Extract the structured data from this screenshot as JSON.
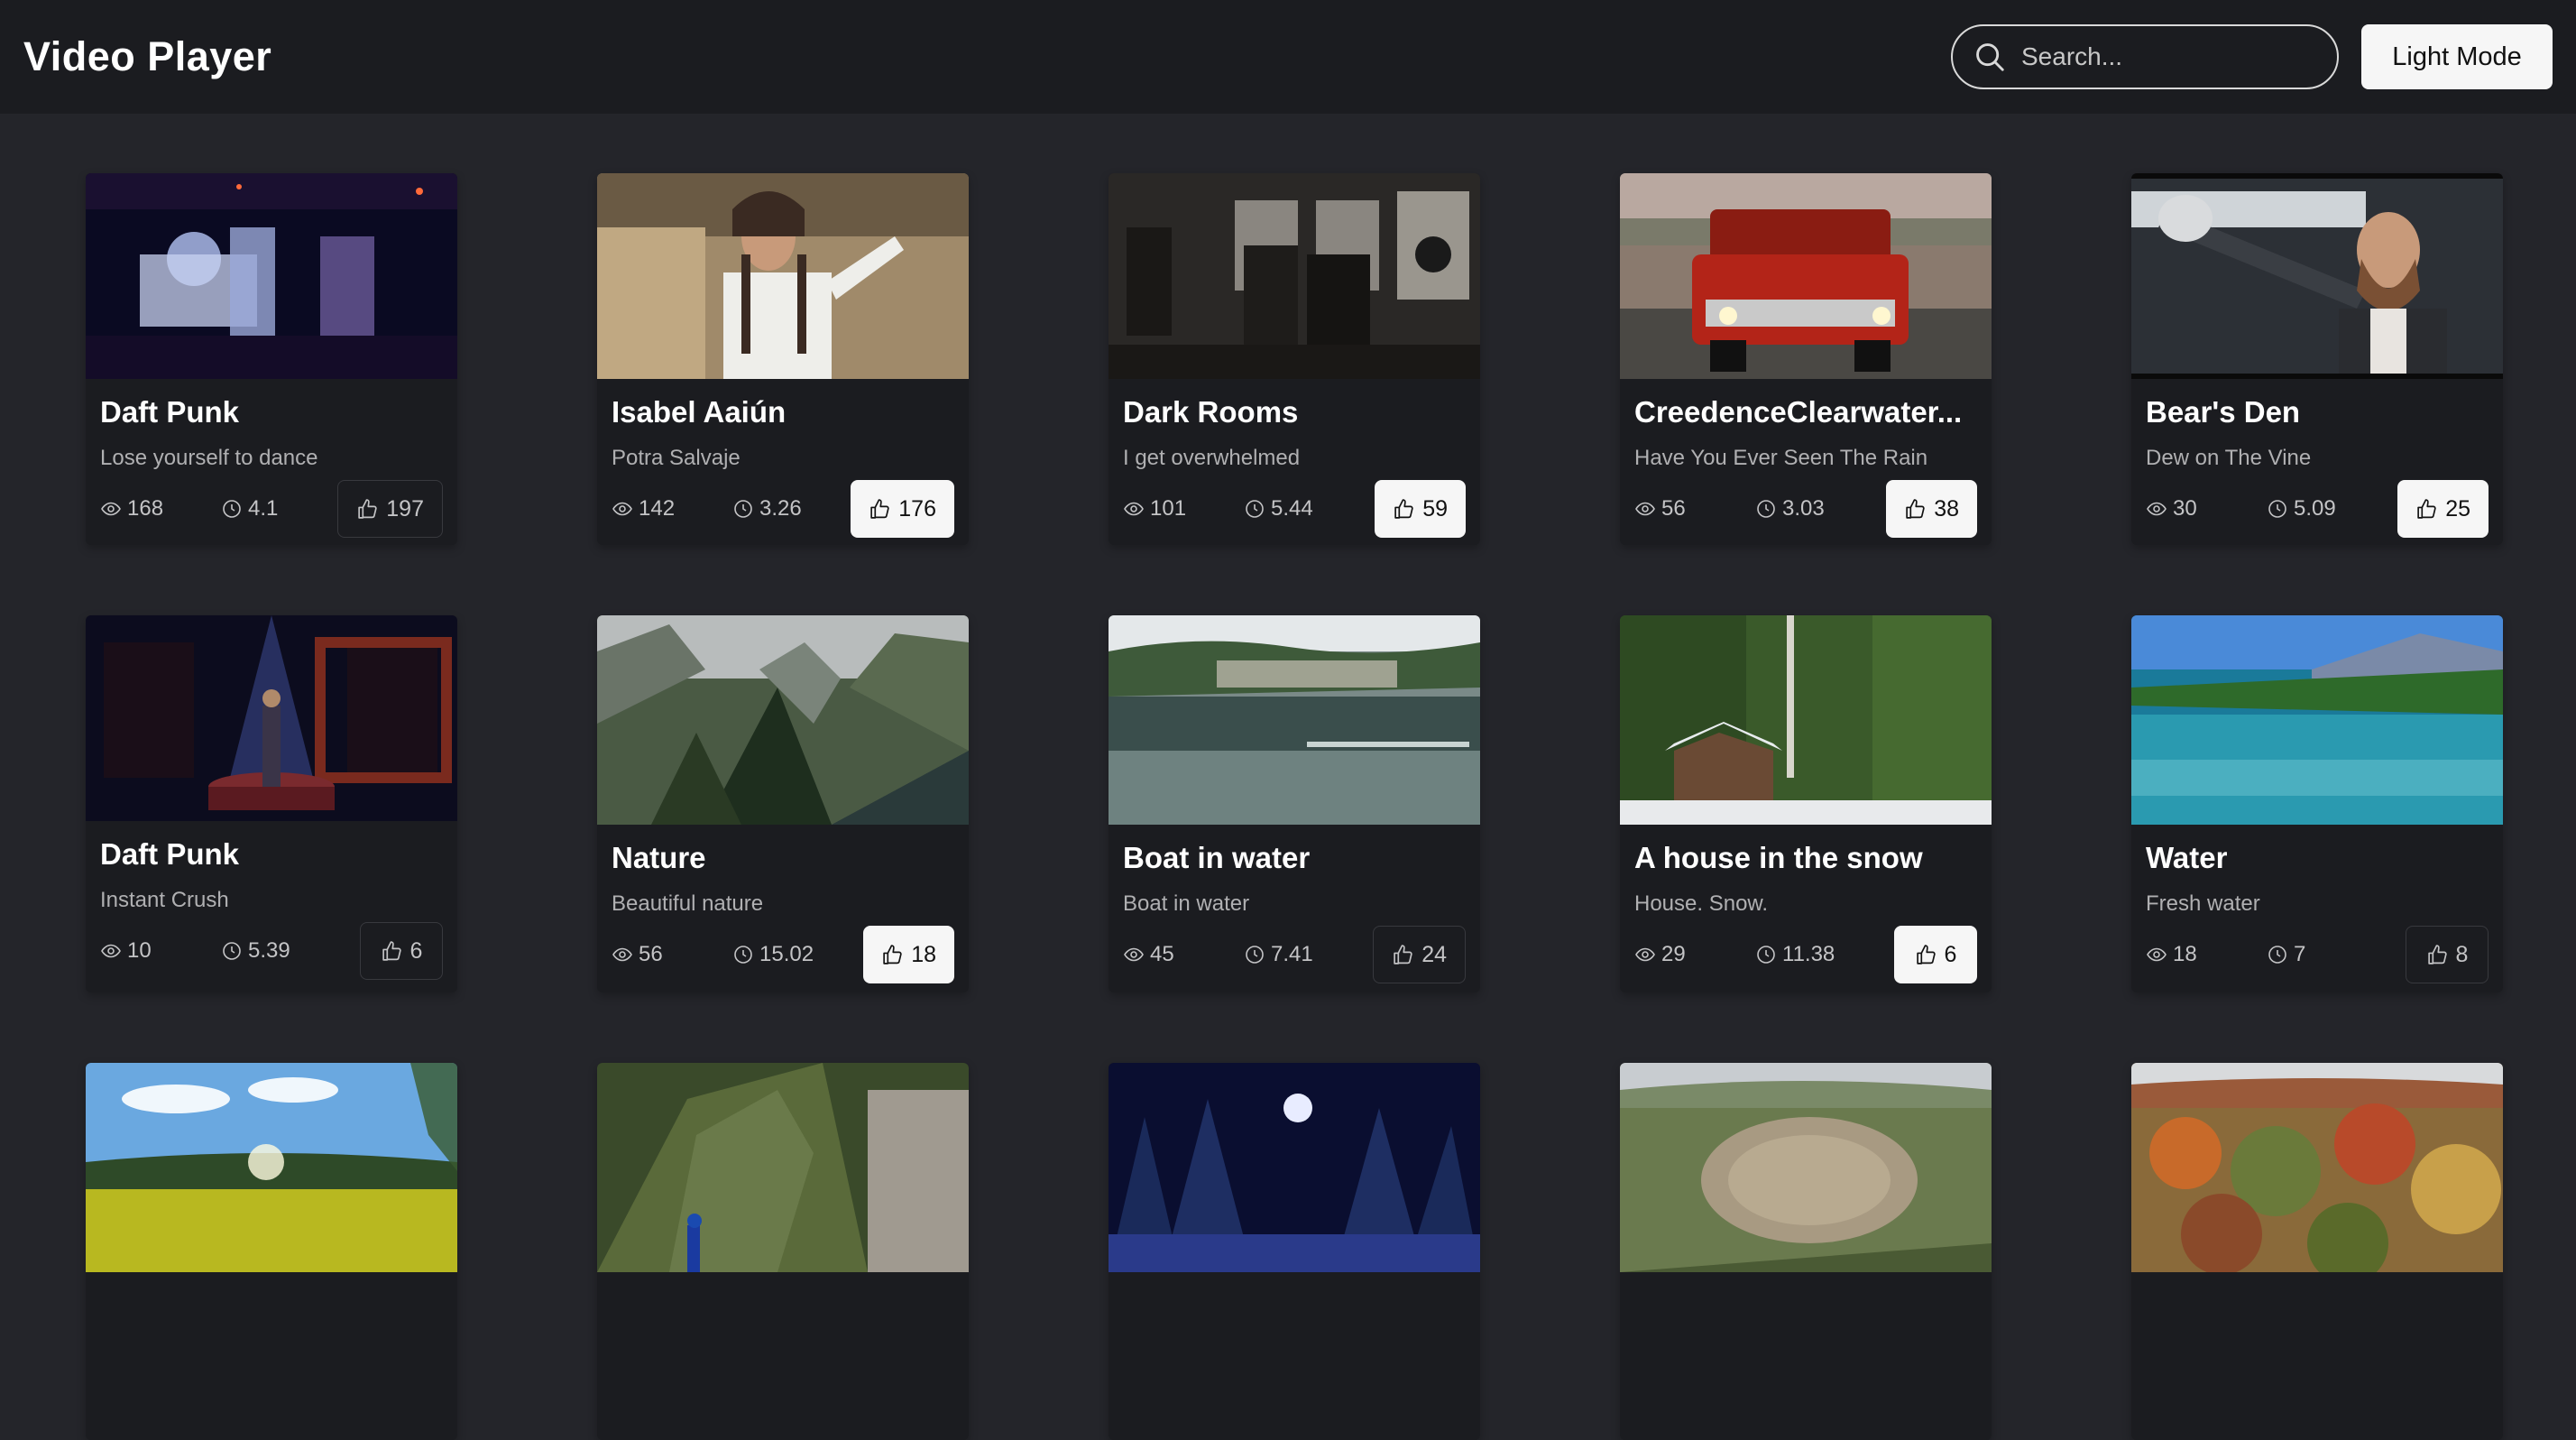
{
  "header": {
    "title": "Video Player",
    "search_placeholder": "Search...",
    "mode_button": "Light Mode"
  },
  "icons": {
    "search": "search-icon",
    "views": "eye-icon",
    "duration": "clock-icon",
    "likes": "thumbs-up-icon"
  },
  "colors": {
    "background": "#24252a",
    "header": "#1b1c20",
    "card": "#1b1c20",
    "like_active": "#f6f6f6"
  },
  "videos": [
    {
      "title": "Daft Punk",
      "subtitle": "Lose yourself to dance",
      "views": "168",
      "duration": "4.1",
      "likes": "197",
      "liked": false
    },
    {
      "title": "Isabel Aaiún",
      "subtitle": "Potra Salvaje",
      "views": "142",
      "duration": "3.26",
      "likes": "176",
      "liked": true
    },
    {
      "title": "Dark Rooms",
      "subtitle": "I get overwhelmed",
      "views": "101",
      "duration": "5.44",
      "likes": "59",
      "liked": true
    },
    {
      "title": "CreedenceClearwater...",
      "subtitle": "Have You Ever Seen The Rain",
      "views": "56",
      "duration": "3.03",
      "likes": "38",
      "liked": true
    },
    {
      "title": "Bear's Den",
      "subtitle": "Dew on The Vine",
      "views": "30",
      "duration": "5.09",
      "likes": "25",
      "liked": true
    },
    {
      "title": "Daft Punk",
      "subtitle": "Instant Crush",
      "views": "10",
      "duration": "5.39",
      "likes": "6",
      "liked": false
    },
    {
      "title": "Nature",
      "subtitle": "Beautiful nature",
      "views": "56",
      "duration": "15.02",
      "likes": "18",
      "liked": true
    },
    {
      "title": "Boat in water",
      "subtitle": "Boat in water",
      "views": "45",
      "duration": "7.41",
      "likes": "24",
      "liked": false
    },
    {
      "title": "A house in the snow",
      "subtitle": "House. Snow.",
      "views": "29",
      "duration": "11.38",
      "likes": "6",
      "liked": true
    },
    {
      "title": "Water",
      "subtitle": "Fresh water",
      "views": "18",
      "duration": "7",
      "likes": "8",
      "liked": false
    }
  ]
}
